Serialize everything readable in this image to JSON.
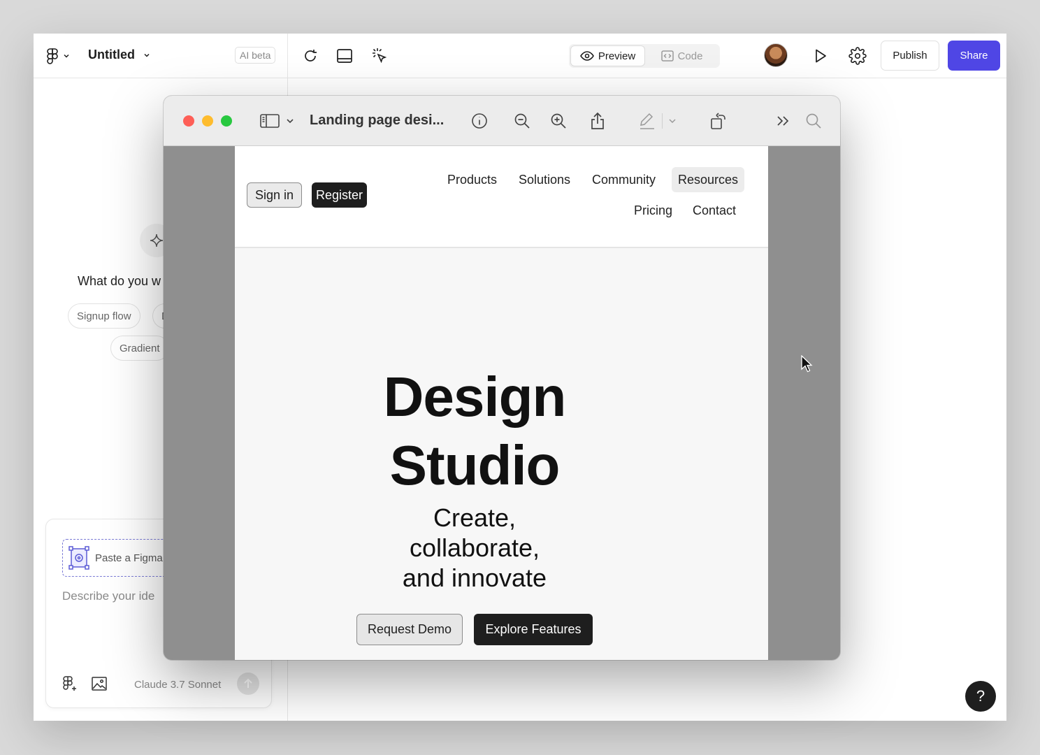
{
  "app": {
    "file_title": "Untitled",
    "ai_badge": "AI beta",
    "toolbar": {
      "preview_label": "Preview",
      "code_label": "Code",
      "publish_label": "Publish",
      "share_label": "Share"
    },
    "colors": {
      "accent": "#4f46e5"
    }
  },
  "left_panel": {
    "prompt_question": "What do you w",
    "suggestions": [
      "Signup flow",
      "D",
      "Gradient"
    ],
    "composer": {
      "paste_label": "Paste a Figma",
      "placeholder": "Describe your ide",
      "model": "Claude 3.7 Sonnet"
    }
  },
  "preview_window": {
    "title": "Landing page desi...",
    "page": {
      "signin_label": "Sign in",
      "register_label": "Register",
      "nav": [
        "Products",
        "Solutions",
        "Community",
        "Resources",
        "Pricing",
        "Contact"
      ],
      "hero_title_line1": "Design",
      "hero_title_line2": "Studio",
      "hero_sub_line1": "Create,",
      "hero_sub_line2": "collaborate,",
      "hero_sub_line3": "and innovate",
      "demo_label": "Request Demo",
      "explore_label": "Explore Features"
    }
  },
  "help_label": "?"
}
